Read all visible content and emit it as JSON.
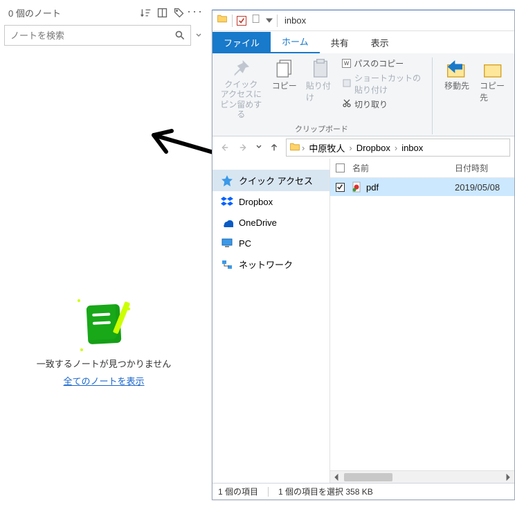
{
  "notes": {
    "count_label": "0 個のノート",
    "search_placeholder": "ノートを検索",
    "no_results_msg": "一致するノートが見つかりません",
    "show_all_link": "全てのノートを表示"
  },
  "explorer": {
    "window_title": "inbox",
    "tabs": {
      "file": "ファイル",
      "home": "ホーム",
      "share": "共有",
      "view": "表示"
    },
    "ribbon": {
      "pin_to_quick_access": "クイック アクセスにピン留めする",
      "copy": "コピー",
      "paste": "貼り付け",
      "copy_path": "パスのコピー",
      "paste_shortcut": "ショートカットの貼り付け",
      "cut": "切り取り",
      "clipboard_group": "クリップボード",
      "move_to": "移動先",
      "copy_to": "コピー先"
    },
    "breadcrumbs": [
      "中原牧人",
      "Dropbox",
      "inbox"
    ],
    "tree": {
      "quick_access": "クイック アクセス",
      "dropbox": "Dropbox",
      "onedrive": "OneDrive",
      "pc": "PC",
      "network": "ネットワーク"
    },
    "headers": {
      "name": "名前",
      "date": "日付時刻"
    },
    "files": [
      {
        "name": "pdf",
        "date": "2019/05/08"
      }
    ],
    "status": {
      "item_count": "1 個の項目",
      "selection": "1 個の項目を選択 358 KB"
    }
  }
}
